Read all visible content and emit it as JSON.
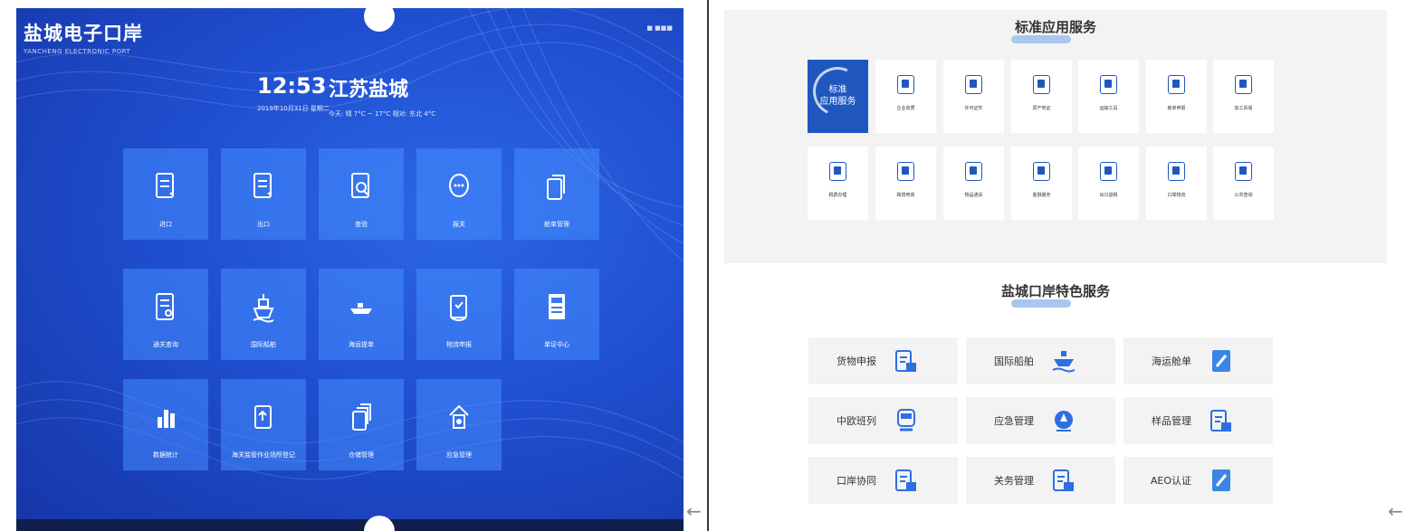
{
  "left_panel": {
    "brand_title": "盐城电子口岸",
    "brand_sub": "YANCHENG ELECTRONIC PORT",
    "top_right": "■ ■■■",
    "time": "12:53",
    "date": "2019年10月31日 星期二",
    "city": "江苏盐城",
    "weather": "今天: 晴   7°C ~ 17°C   相对: 东北 4°C",
    "tiles": [
      {
        "label": "进口",
        "icon": "document-icon"
      },
      {
        "label": "出口",
        "icon": "document-icon"
      },
      {
        "label": "查验",
        "icon": "search-document-icon"
      },
      {
        "label": "报关",
        "icon": "chat-icon"
      },
      {
        "label": "舱单管理",
        "icon": "copy-icon"
      },
      {
        "label": "通关查询",
        "icon": "form-icon"
      },
      {
        "label": "国际船舶",
        "icon": "ship-icon"
      },
      {
        "label": "海运提单",
        "icon": "cargo-ship-icon"
      },
      {
        "label": "物流申报",
        "icon": "clipboard-icon"
      },
      {
        "label": "单证中心",
        "icon": "page-icon"
      },
      {
        "label": "数据统计",
        "icon": "chart-icon"
      },
      {
        "label": "海关监管作业场所登记",
        "icon": "upload-document-icon"
      },
      {
        "label": "仓储管理",
        "icon": "stack-icon"
      },
      {
        "label": "应急管理",
        "icon": "house-icon"
      }
    ]
  },
  "right_panel": {
    "standard_title": "标准应用服务",
    "feature_label_line1": "标准",
    "feature_label_line2": "应用服务",
    "standard_items": [
      "企业资质",
      "许可证件",
      "原产地证",
      "运输工具",
      "舱单申报",
      "加工贸易",
      "税费办理",
      "跨境电商",
      "物品通关",
      "金融服务",
      "出口退税",
      "口岸物流",
      "公共查询"
    ],
    "special_title": "盐城口岸特色服务",
    "special_items": [
      {
        "label": "货物申报",
        "icon": "clipboard-box-icon"
      },
      {
        "label": "国际船舶",
        "icon": "ship-icon"
      },
      {
        "label": "海运舱单",
        "icon": "notebook-icon"
      },
      {
        "label": "中欧班列",
        "icon": "train-icon"
      },
      {
        "label": "应急管理",
        "icon": "alarm-icon"
      },
      {
        "label": "样品管理",
        "icon": "clipboard-box-icon"
      },
      {
        "label": "口岸协同",
        "icon": "clipboard-box-icon"
      },
      {
        "label": "关务管理",
        "icon": "clipboard-box-icon"
      },
      {
        "label": "AEO认证",
        "icon": "notebook-icon"
      }
    ]
  },
  "back_arrow_glyph": "←",
  "colors": {
    "left_bg": "#1f4fd0",
    "tile": "#468cff",
    "accent": "#1f57bf"
  }
}
